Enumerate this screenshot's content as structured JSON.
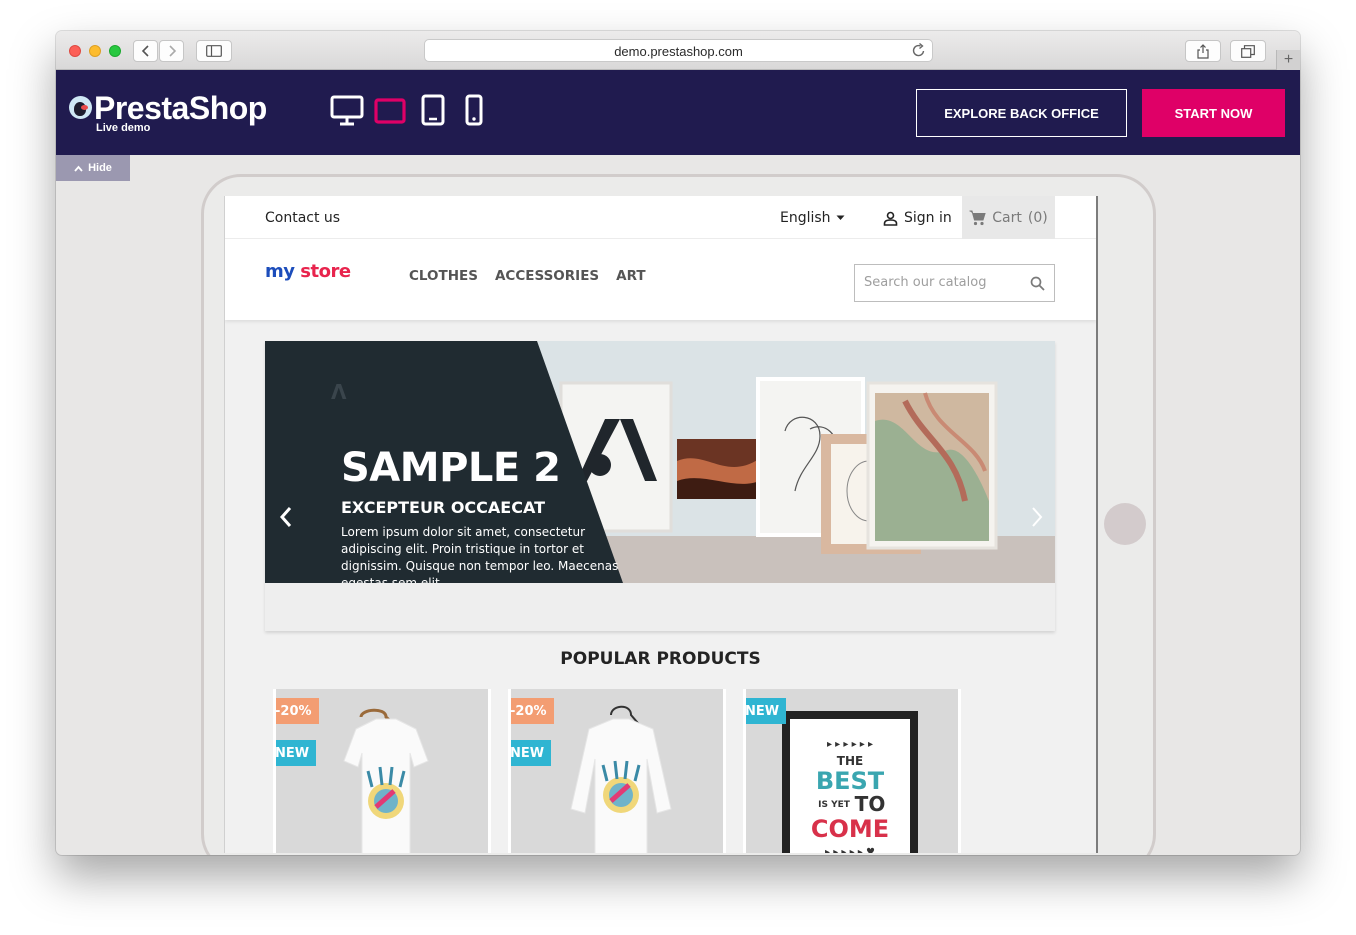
{
  "browser": {
    "url": "demo.prestashop.com"
  },
  "demo_bar": {
    "logo_text": "PrestaShop",
    "logo_sub": "Live demo",
    "explore_label": "EXPLORE BACK OFFICE",
    "start_label": "START NOW",
    "hide_label": "Hide",
    "devices": [
      "desktop-icon",
      "tablet-landscape-icon",
      "tablet-portrait-icon",
      "mobile-icon"
    ],
    "colors": {
      "bar": "#201b4f",
      "accent": "#df0067"
    }
  },
  "store": {
    "contact_label": "Contact us",
    "language": "English",
    "signin_label": "Sign in",
    "cart_label": "Cart",
    "cart_count": "(0)",
    "logo": "my store",
    "menu": [
      "CLOTHES",
      "ACCESSORIES",
      "ART"
    ],
    "search_placeholder": "Search our catalog"
  },
  "slider": {
    "title": "SAMPLE 2",
    "subtitle": "EXCEPTEUR OCCAECAT",
    "body": "Lorem ipsum dolor sit amet, consectetur adipiscing elit. Proin tristique in tortor et dignissim. Quisque non tempor leo. Maecenas egestas sem elit"
  },
  "popular": {
    "title": "POPULAR PRODUCTS",
    "products": [
      {
        "discount": "-20%",
        "flag": "NEW"
      },
      {
        "discount": "-20%",
        "flag": "NEW"
      },
      {
        "flag": "NEW",
        "poster_lines": [
          "THE",
          "BEST",
          "IS YET",
          "TO",
          "COME"
        ]
      }
    ]
  }
}
